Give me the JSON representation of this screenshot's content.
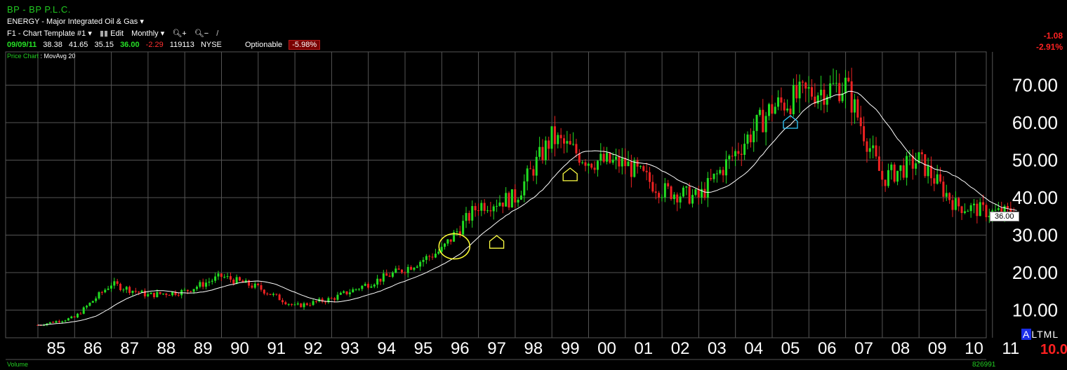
{
  "header": {
    "title": "BP - BP P.L.C.",
    "sector": "ENERGY - Major Integrated Oil & Gas",
    "template": "F1 - Chart Template #1",
    "edit_label": "Edit",
    "period": "Monthly",
    "date": "09/09/11",
    "open": "38.38",
    "high": "41.65",
    "low": "35.15",
    "close": "36.00",
    "change": "-2.29",
    "volume": "119113",
    "exchange": "NYSE",
    "optionable": "Optionable",
    "pct_change": "-5.98%",
    "price_chart": "Price Chart",
    "mov_avg": "MovAvg 20",
    "right_change": "-1.08",
    "right_pct": "-2.91%"
  },
  "footer": {
    "volume_label": "Volume",
    "volume_value": "826991",
    "scale_modes": [
      "A",
      "L",
      "T",
      "M",
      "L"
    ],
    "scale_big": "10.0"
  },
  "last_price_tag": "36.00",
  "colors": {
    "up": "#22dd22",
    "down": "#ee2222",
    "grid": "#555555",
    "ma": "#ffffff",
    "bg": "#000000"
  },
  "chart_data": {
    "type": "candlestick",
    "ticker": "BP",
    "x_tick_labels": [
      "85",
      "86",
      "87",
      "88",
      "89",
      "90",
      "91",
      "92",
      "93",
      "94",
      "95",
      "96",
      "97",
      "98",
      "99",
      "00",
      "01",
      "02",
      "03",
      "04",
      "05",
      "06",
      "07",
      "08",
      "09",
      "10",
      "11"
    ],
    "y_tick_labels": [
      "10.00",
      "20.00",
      "30.00",
      "40.00",
      "50.00",
      "60.00",
      "70.00"
    ],
    "ylim": [
      0,
      80
    ],
    "grid": true,
    "moving_average": "MovAvg 20",
    "price_path_by_year": [
      {
        "year": "85",
        "close": 6
      },
      {
        "year": "86",
        "close": 8
      },
      {
        "year": "87",
        "close": 17
      },
      {
        "year": "88",
        "close": 14
      },
      {
        "year": "89",
        "close": 15
      },
      {
        "year": "90",
        "close": 19
      },
      {
        "year": "91",
        "close": 16
      },
      {
        "year": "92",
        "close": 11
      },
      {
        "year": "93",
        "close": 13
      },
      {
        "year": "94",
        "close": 17
      },
      {
        "year": "95",
        "close": 21
      },
      {
        "year": "96",
        "close": 26
      },
      {
        "year": "97",
        "close": 38
      },
      {
        "year": "98",
        "close": 40
      },
      {
        "year": "99",
        "close": 56
      },
      {
        "year": "00",
        "close": 50
      },
      {
        "year": "01",
        "close": 49
      },
      {
        "year": "02",
        "close": 42
      },
      {
        "year": "03",
        "close": 40
      },
      {
        "year": "04",
        "close": 52
      },
      {
        "year": "05",
        "close": 64
      },
      {
        "year": "06",
        "close": 68
      },
      {
        "year": "07",
        "close": 70
      },
      {
        "year": "08",
        "close": 45
      },
      {
        "year": "09",
        "close": 50
      },
      {
        "year": "10",
        "close": 38
      },
      {
        "year": "11",
        "close": 36
      }
    ],
    "annotations": [
      {
        "type": "circle",
        "near_year": "96",
        "value": 27
      },
      {
        "type": "arrow",
        "near_year": "97",
        "value": 28
      },
      {
        "type": "arrow",
        "near_year": "99",
        "value": 46
      },
      {
        "type": "arrow",
        "near_year": "05",
        "value": 60
      }
    ]
  }
}
